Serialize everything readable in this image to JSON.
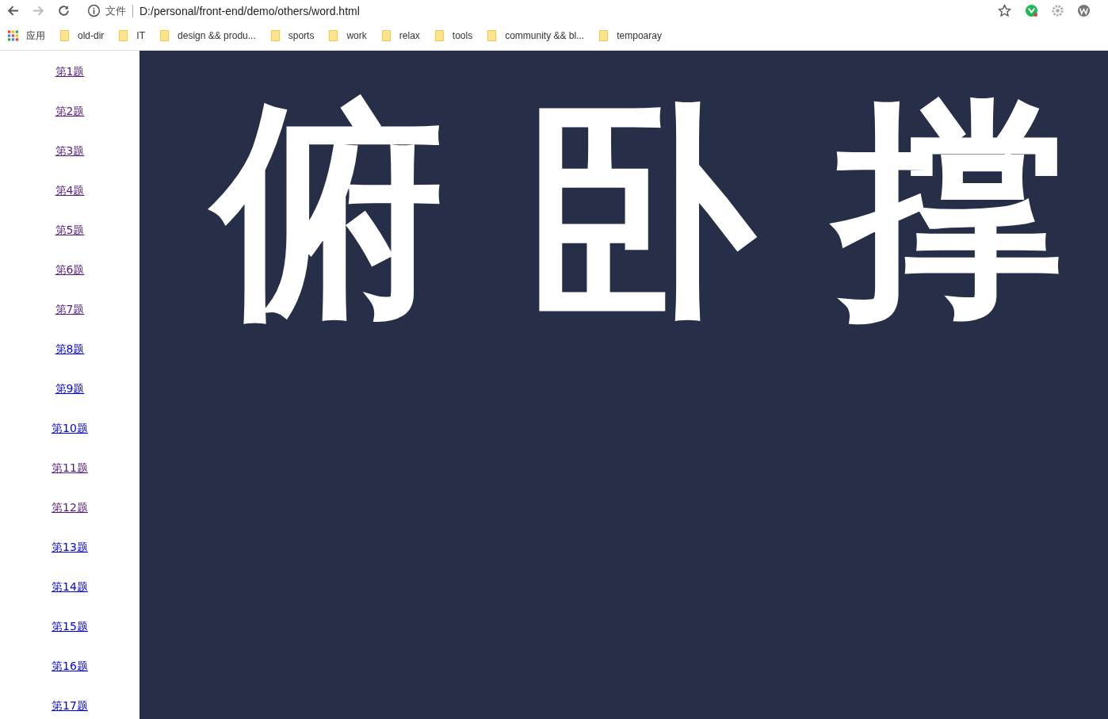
{
  "browser": {
    "security_label": "文件",
    "url": "D:/personal/front-end/demo/others/word.html"
  },
  "bookmarks": [
    {
      "label": "应用",
      "kind": "apps"
    },
    {
      "label": "old-dir",
      "kind": "folder"
    },
    {
      "label": "IT",
      "kind": "folder"
    },
    {
      "label": "design && produ...",
      "kind": "folder"
    },
    {
      "label": "sports",
      "kind": "folder"
    },
    {
      "label": "work",
      "kind": "folder"
    },
    {
      "label": "relax",
      "kind": "folder"
    },
    {
      "label": "tools",
      "kind": "folder"
    },
    {
      "label": "community && bl...",
      "kind": "folder"
    },
    {
      "label": "tempoaray",
      "kind": "folder"
    }
  ],
  "sidebar": {
    "links": [
      {
        "label": "第1题",
        "visited": true
      },
      {
        "label": "第2题",
        "visited": true
      },
      {
        "label": "第3题",
        "visited": true
      },
      {
        "label": "第4题",
        "visited": true
      },
      {
        "label": "第5题",
        "visited": true
      },
      {
        "label": "第6题",
        "visited": true
      },
      {
        "label": "第7题",
        "visited": true
      },
      {
        "label": "第8题",
        "visited": false
      },
      {
        "label": "第9题",
        "visited": false
      },
      {
        "label": "第10题",
        "visited": false
      },
      {
        "label": "第11题",
        "visited": true
      },
      {
        "label": "第12题",
        "visited": true
      },
      {
        "label": "第13题",
        "visited": false
      },
      {
        "label": "第14题",
        "visited": false
      },
      {
        "label": "第15题",
        "visited": false
      },
      {
        "label": "第16题",
        "visited": false
      },
      {
        "label": "第17题",
        "visited": false
      }
    ]
  },
  "main": {
    "characters": [
      "俯",
      "卧",
      "撑"
    ]
  }
}
